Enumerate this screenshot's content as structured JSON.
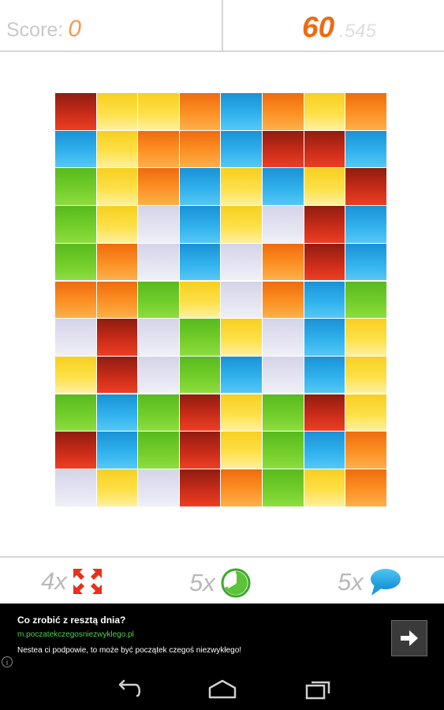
{
  "header": {
    "score_label": "Score:",
    "score_value": "0",
    "timer_main": "60",
    "timer_fraction": ".545"
  },
  "board": {
    "columns": 8,
    "rows": 11,
    "grid": [
      [
        "red",
        "yellow",
        "yellow",
        "orange",
        "blue",
        "orange",
        "yellow",
        "orange"
      ],
      [
        "blue",
        "yellow",
        "orange",
        "orange",
        "blue",
        "red",
        "red",
        "blue"
      ],
      [
        "green",
        "yellow",
        "orange",
        "blue",
        "yellow",
        "blue",
        "yellow",
        "red"
      ],
      [
        "green",
        "yellow",
        "gray",
        "blue",
        "yellow",
        "gray",
        "red",
        "blue"
      ],
      [
        "green",
        "orange",
        "gray",
        "blue",
        "gray",
        "orange",
        "red",
        "blue"
      ],
      [
        "orange",
        "orange",
        "green",
        "yellow",
        "gray",
        "orange",
        "blue",
        "green"
      ],
      [
        "gray",
        "red",
        "gray",
        "green",
        "yellow",
        "gray",
        "blue",
        "yellow"
      ],
      [
        "yellow",
        "red",
        "gray",
        "green",
        "blue",
        "gray",
        "blue",
        "yellow"
      ],
      [
        "green",
        "blue",
        "green",
        "red",
        "yellow",
        "green",
        "red",
        "yellow"
      ],
      [
        "red",
        "blue",
        "green",
        "red",
        "yellow",
        "green",
        "blue",
        "orange"
      ],
      [
        "gray",
        "yellow",
        "gray",
        "red",
        "orange",
        "green",
        "yellow",
        "orange"
      ]
    ]
  },
  "powerups": [
    {
      "count": "4x",
      "icon": "expand-arrows-icon"
    },
    {
      "count": "5x",
      "icon": "clock-icon"
    },
    {
      "count": "5x",
      "icon": "speech-bubble-icon"
    }
  ],
  "ad": {
    "title": "Co zrobić z resztą dnia?",
    "url": "m.poczatekczegosniezwyklego.pl",
    "description": "Nestea ci podpowie, to może być początek czegoś niezwykłego!",
    "info": "i"
  },
  "colors": {
    "accent_orange": "#f06a12",
    "score_orange": "#f59a4a",
    "ad_url_green": "#4fcf4f"
  }
}
